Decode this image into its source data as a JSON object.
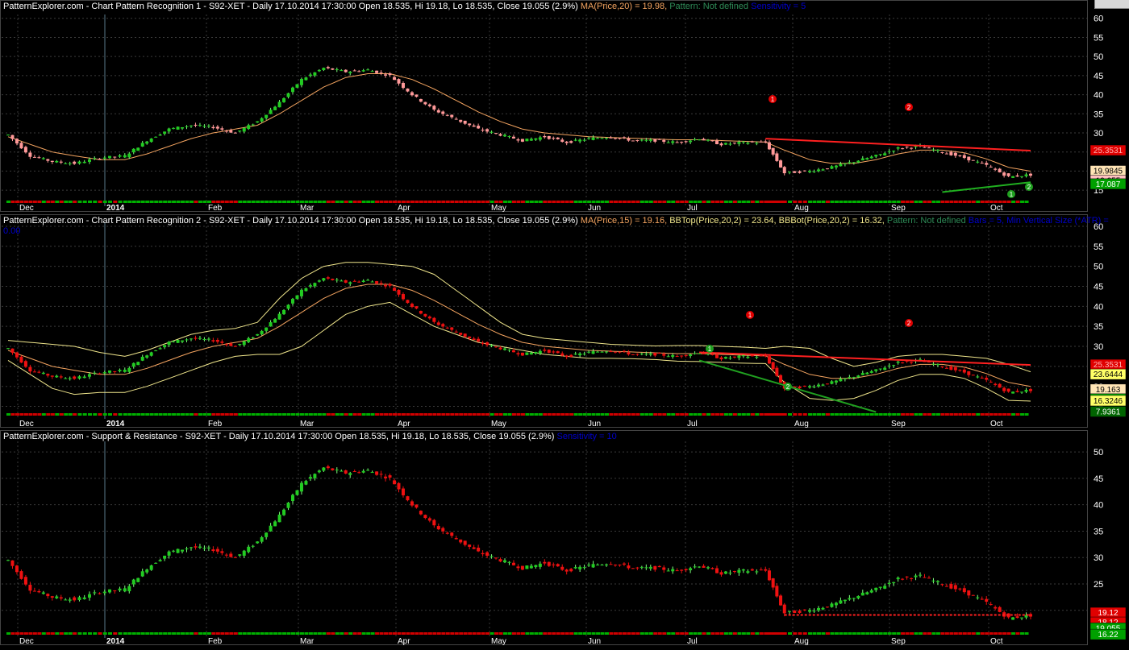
{
  "panels": [
    {
      "title_segments": [
        {
          "text": "PatternExplorer.com - Chart Pattern Recognition 1  - S92-XET - Daily 17.10.2014 17:30:00 Open 18.535, Hi 19.18, Lo 18.535, Close 19.055 (2.9%) ",
          "color": "#ffffff"
        },
        {
          "text": "MA(Price,20) = 19.98, ",
          "color": "#f4a460"
        },
        {
          "text": "Pattern: Not defined ",
          "color": "#2e8b57"
        },
        {
          "text": "Sensitivity = 5",
          "color": "#0000cd"
        }
      ],
      "y_ticks": [
        15,
        20,
        25,
        30,
        35,
        40,
        45,
        50,
        55,
        60
      ],
      "ylim": [
        12.5,
        61
      ],
      "tags": [
        {
          "text": "25.3531",
          "bg": "#e00000",
          "fg": "#ffb0b0",
          "value": 25.3531
        },
        {
          "text": "19.9845",
          "bg": "#ffe4b5",
          "fg": "#000000",
          "value": 19.9845
        },
        {
          "text": "19.055",
          "bg": "#ffc0c0",
          "fg": "#000000",
          "value": 19.055
        },
        {
          "text": "17.087",
          "bg": "#00a000",
          "fg": "#ffffff",
          "value": 17.087
        }
      ],
      "markers": [
        "1",
        "2",
        "1",
        "2"
      ]
    },
    {
      "title_segments": [
        {
          "text": "PatternExplorer.com - Chart Pattern Recognition 2 - S92-XET - Daily 17.10.2014 17:30:00 Open 18.535, Hi 19.18, Lo 18.535, Close 19.055 (2.9%) ",
          "color": "#ffffff"
        },
        {
          "text": "MA(Price,15) = 19.16, ",
          "color": "#f4a460"
        },
        {
          "text": "BBTop(Price,20,2) = 23.64, ",
          "color": "#f0e68c"
        },
        {
          "text": "BBBot(Price,20,2) = 16.32, ",
          "color": "#f0e68c"
        },
        {
          "text": "Pattern: Not defined ",
          "color": "#2e8b57"
        },
        {
          "text": "Bars = 5, Min Vertical Size (*ATR) = ",
          "color": "#0000cd"
        }
      ],
      "title_line2": "0.00",
      "y_ticks": [
        15,
        20,
        25,
        30,
        35,
        40,
        45,
        50,
        55,
        60
      ],
      "ylim": [
        13.5,
        61
      ],
      "tags": [
        {
          "text": "25.3531",
          "bg": "#e00000",
          "fg": "#ffb0b0",
          "value": 25.3531
        },
        {
          "text": "23.6444",
          "bg": "#ffff66",
          "fg": "#000000",
          "value": 23.6444
        },
        {
          "text": "19.163",
          "bg": "#ffe4b5",
          "fg": "#000000",
          "value": 19.163
        },
        {
          "text": "19.055",
          "bg": "#00a000",
          "fg": "#ffffff",
          "value": 19.055
        },
        {
          "text": "16.3246",
          "bg": "#ffff66",
          "fg": "#000000",
          "value": 16.3246
        },
        {
          "text": "7.9361",
          "bg": "#006400",
          "fg": "#ffffff",
          "value": 13.6
        }
      ],
      "markers": [
        "1",
        "2",
        "1",
        "2"
      ]
    },
    {
      "title_segments": [
        {
          "text": "PatternExplorer.com - Support & Resistance - S92-XET - Daily 17.10.2014 17:30:00 Open 18.535, Hi 19.18, Lo 18.535, Close 19.055 (2.9%) ",
          "color": "#ffffff"
        },
        {
          "text": "Sensitivity = 10",
          "color": "#0000cd"
        }
      ],
      "y_ticks": [
        20,
        25,
        30,
        35,
        40,
        45,
        50
      ],
      "ylim": [
        16,
        52
      ],
      "tags": [
        {
          "text": "19.12",
          "bg": "#e00000",
          "fg": "#ffffff",
          "value": 19.5
        },
        {
          "text": "18.12",
          "bg": "#e00000",
          "fg": "#ffffff",
          "value": 18.4
        },
        {
          "text": "19.055",
          "bg": "#00a000",
          "fg": "#ffffff",
          "value": 17.2
        },
        {
          "text": "16.22",
          "bg": "#00a000",
          "fg": "#ffffff",
          "value": 16.1
        }
      ],
      "markers": []
    }
  ],
  "x_axis_labels": [
    "Dec",
    "2014",
    "Feb",
    "Mar",
    "Apr",
    "May",
    "Jun",
    "Jul",
    "Aug",
    "Sep",
    "Oct"
  ],
  "chart_data": {
    "type": "candlestick",
    "symbol": "S92-XET",
    "last": {
      "date": "17.10.2014",
      "open": 18.535,
      "high": 19.18,
      "low": 18.535,
      "close": 19.055
    },
    "x_dates": [
      "2013-11-27",
      "2013-12-04",
      "2013-12-11",
      "2013-12-18",
      "2013-12-26",
      "2014-01-03",
      "2014-01-10",
      "2014-01-17",
      "2014-01-24",
      "2014-01-31",
      "2014-02-07",
      "2014-02-14",
      "2014-02-21",
      "2014-02-28",
      "2014-03-07",
      "2014-03-14",
      "2014-03-21",
      "2014-03-28",
      "2014-04-04",
      "2014-04-11",
      "2014-04-18",
      "2014-04-25",
      "2014-05-02",
      "2014-05-09",
      "2014-05-16",
      "2014-05-23",
      "2014-05-30",
      "2014-06-06",
      "2014-06-13",
      "2014-06-20",
      "2014-06-27",
      "2014-07-04",
      "2014-07-11",
      "2014-07-18",
      "2014-07-25",
      "2014-07-31",
      "2014-08-08",
      "2014-08-15",
      "2014-08-22",
      "2014-08-29",
      "2014-09-05",
      "2014-09-12",
      "2014-09-19",
      "2014-09-26",
      "2014-10-03",
      "2014-10-10",
      "2014-10-17"
    ],
    "close": [
      29.5,
      24.0,
      22.5,
      22.0,
      23.5,
      24.0,
      28.0,
      31.0,
      32.0,
      31.5,
      30.0,
      33.0,
      38.0,
      44.0,
      47.0,
      46.0,
      46.5,
      45.0,
      40.0,
      36.0,
      33.5,
      31.0,
      29.5,
      28.0,
      29.0,
      27.5,
      28.5,
      29.0,
      28.0,
      28.0,
      27.5,
      28.5,
      27.0,
      27.5,
      27.5,
      19.5,
      20.0,
      21.0,
      22.5,
      24.0,
      26.0,
      26.5,
      25.0,
      23.5,
      21.5,
      18.5,
      19.055
    ],
    "ma": [
      29.0,
      27.0,
      25.0,
      24.0,
      23.0,
      23.0,
      24.5,
      26.5,
      28.5,
      30.0,
      31.0,
      32.0,
      35.0,
      38.5,
      42.0,
      44.5,
      45.5,
      45.5,
      44.0,
      41.5,
      38.5,
      35.5,
      33.0,
      31.0,
      30.0,
      29.5,
      29.0,
      28.8,
      28.6,
      28.4,
      28.2,
      28.2,
      28.0,
      27.8,
      27.6,
      25.5,
      23.0,
      22.0,
      22.0,
      23.0,
      24.5,
      25.5,
      25.5,
      24.8,
      23.2,
      21.0,
      19.98
    ],
    "bb_top": [
      31.5,
      31.0,
      30.5,
      30.0,
      28.5,
      27.5,
      29.0,
      31.0,
      33.0,
      34.0,
      34.5,
      36.0,
      42.0,
      47.0,
      50.0,
      51.0,
      51.0,
      50.5,
      50.0,
      48.0,
      44.0,
      40.0,
      36.0,
      33.0,
      32.0,
      31.5,
      31.0,
      30.5,
      30.3,
      30.1,
      30.2,
      30.2,
      30.0,
      29.8,
      29.5,
      30.0,
      29.5,
      27.0,
      25.0,
      26.0,
      27.5,
      28.0,
      28.0,
      27.5,
      27.0,
      25.5,
      23.64
    ],
    "bb_bot": [
      26.5,
      23.0,
      19.5,
      18.0,
      18.5,
      18.5,
      20.0,
      22.0,
      24.0,
      26.0,
      27.5,
      28.0,
      28.0,
      30.0,
      34.0,
      38.0,
      40.0,
      41.0,
      38.0,
      35.0,
      33.0,
      31.0,
      30.0,
      29.0,
      28.0,
      27.5,
      27.0,
      27.0,
      26.9,
      26.7,
      26.3,
      26.2,
      26.0,
      25.8,
      25.7,
      21.0,
      17.0,
      16.5,
      17.0,
      19.0,
      21.5,
      23.0,
      23.0,
      22.0,
      19.5,
      16.5,
      16.32
    ],
    "ma_top_label": "MA(Price,20) = 19.98",
    "ma_bottom_label": "MA(Price,15) = 19.16",
    "pattern_lines": {
      "panel1_resistance": {
        "from": {
          "x": "2014-07-25",
          "y": 28.5
        },
        "to": {
          "x": "2014-10-17",
          "y": 25.3531
        }
      },
      "panel1_support": {
        "from": {
          "x": "2014-09-19",
          "y": 14.5
        },
        "to": {
          "x": "2014-10-17",
          "y": 17.087
        }
      },
      "panel2_resistance": {
        "from": {
          "x": "2014-07-04",
          "y": 28.5
        },
        "to": {
          "x": "2014-10-17",
          "y": 25.3531
        }
      },
      "panel2_support": {
        "from": {
          "x": "2014-07-04",
          "y": 26.5
        },
        "to": {
          "x": "2014-08-29",
          "y": 13.6
        }
      },
      "panel3_support": {
        "from": {
          "x": "2014-07-31",
          "y": 19.12
        },
        "to": {
          "x": "2014-10-17",
          "y": 19.12
        }
      }
    }
  }
}
